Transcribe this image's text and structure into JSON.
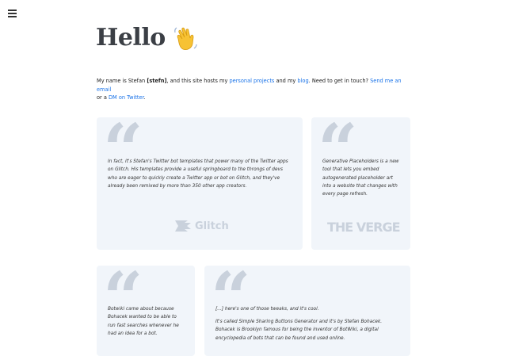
{
  "header": {
    "menu_icon": "hamburger-menu-icon",
    "title": "Hello",
    "title_emoji_icon": "waving-hand-icon"
  },
  "intro": {
    "t1": "My name is Stefan ",
    "handle": "[stefn]",
    "t2": ", and this site hosts my ",
    "link_projects": "personal projects",
    "t3": " and my ",
    "link_blog": "blog",
    "t4": ". Need to get in touch? ",
    "link_email": "Send me an email",
    "t5": " or a ",
    "link_twitter": "DM on Twitter",
    "t6": "."
  },
  "colors": {
    "link": "#1a73e8",
    "card_bg": "#f1f5fa",
    "quote_mark": "#c9d1dc",
    "title": "#3b3f45"
  },
  "testimonials": [
    {
      "quote": "In fact, it's Stefan's Twitter bot templates that power many of the Twitter apps on Glitch. His templates provide a useful springboard to the throngs of devs who are eager to quickly create a Twitter app or bot on Glitch, and they've already been remixed by more than 350 other app creators.",
      "source": "Glitch",
      "source_icon": "glitch-fish-icon"
    },
    {
      "quote": "Generative Placeholders is a new tool that lets you embed autogenerated placeholder art into a website that changes with every page refresh.",
      "source": "THE VERGE"
    },
    {
      "quote": "Botwiki came about because Bohacek wanted to be able to run fast searches whenever he had an idea for a bot."
    },
    {
      "quote_p1": "[...] here's one of those tweaks, and it's cool.",
      "quote_p2": "It's called Simple Sharing Buttons Generator and it's by Stefan Bohacek. Bohacek is Brooklyn famous for being the inventor of BotWiki, a digital encyclopedia of bots that can be found and used online."
    }
  ]
}
